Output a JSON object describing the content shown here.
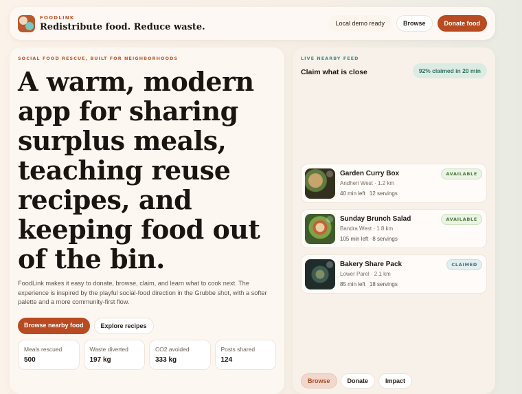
{
  "header": {
    "brand": "FOODLINK",
    "tagline": "Redistribute food. Reduce waste.",
    "status": "Local demo ready",
    "browse": "Browse",
    "donate": "Donate food"
  },
  "hero": {
    "eyebrow": "SOCIAL FOOD RESCUE, BUILT FOR NEIGHBORHOODS",
    "headline": "A warm, modern app for sharing surplus meals, teaching reuse recipes, and keeping food out of the bin.",
    "description": "FoodLink makes it easy to donate, browse, claim, and learn what to cook next. The experience is inspired by the playful social-food direction in the Grubbe shot, with a softer palette and a more community-first flow.",
    "primary_cta": "Browse nearby food",
    "secondary_cta": "Explore recipes",
    "stats": [
      {
        "label": "Meals rescued",
        "value": "500"
      },
      {
        "label": "Waste diverted",
        "value": "197 kg"
      },
      {
        "label": "CO2 avoided",
        "value": "333 kg"
      },
      {
        "label": "Posts shared",
        "value": "124"
      }
    ]
  },
  "feed": {
    "eyebrow": "LIVE NEARBY FEED",
    "title": "Claim what is close",
    "claim_rate": "92% claimed in 20 min",
    "listings": [
      {
        "name": "Garden Curry Box",
        "location": "Andheri West · 1.2 km",
        "time": "40 min left",
        "servings": "12 servings",
        "status": "AVAILABLE",
        "image": "curry-bowl"
      },
      {
        "name": "Sunday Brunch Salad",
        "location": "Bandra West · 1.8 km",
        "time": "105 min left",
        "servings": "8 servings",
        "status": "AVAILABLE",
        "image": "salad-bowl"
      },
      {
        "name": "Bakery Share Pack",
        "location": "Lower Parel · 2.1 km",
        "time": "85 min left",
        "servings": "18 servings",
        "status": "CLAIMED",
        "image": "bakery-plate"
      }
    ],
    "nav": {
      "browse": "Browse",
      "donate": "Donate",
      "impact": "Impact"
    }
  }
}
